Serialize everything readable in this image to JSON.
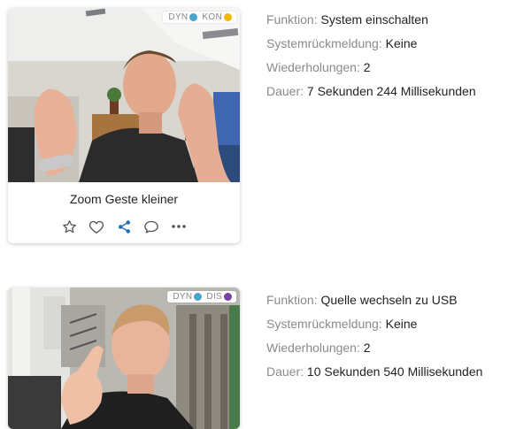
{
  "items": [
    {
      "badge": {
        "left": "DYN",
        "left_color": "#4aa3c8",
        "right": "KON",
        "right_color": "#f2b705"
      },
      "title": "Zoom Geste kleiner",
      "info": [
        {
          "label": "Funktion:",
          "value": "System einschalten"
        },
        {
          "label": "Systemrückmeldung:",
          "value": "Keine"
        },
        {
          "label": "Wiederholungen:",
          "value": "2"
        },
        {
          "label": "Dauer:",
          "value": "7 Sekunden 244 Millisekunden"
        }
      ]
    },
    {
      "badge": {
        "left": "DYN",
        "left_color": "#4aa3c8",
        "right": "DIS",
        "right_color": "#7b3fa6"
      },
      "info": [
        {
          "label": "Funktion:",
          "value": "Quelle wechseln zu USB"
        },
        {
          "label": "Systemrückmeldung:",
          "value": "Keine"
        },
        {
          "label": "Wiederholungen:",
          "value": "2"
        },
        {
          "label": "Dauer:",
          "value": "10 Sekunden 540 Millisekunden"
        }
      ]
    }
  ],
  "actions": [
    "star-icon",
    "heart-icon",
    "share-icon",
    "comment-icon",
    "more-icon"
  ],
  "colors": {
    "share_active": "#1f6fb5",
    "icon": "#555555"
  }
}
